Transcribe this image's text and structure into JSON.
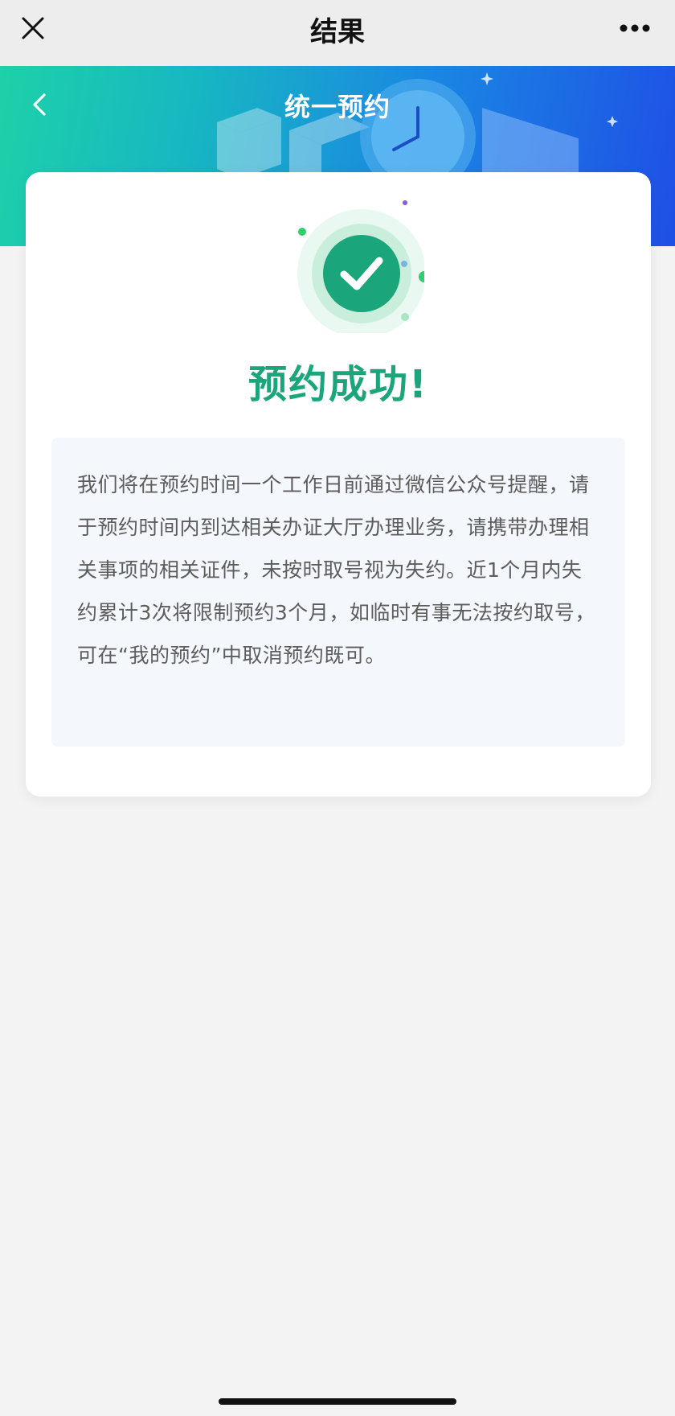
{
  "nav": {
    "title": "结果",
    "close_icon": "close-icon",
    "more_icon": "more-dots-icon"
  },
  "banner": {
    "title": "统一预约",
    "back_icon": "chevron-left-icon",
    "gradient_start": "#1dd1a8",
    "gradient_end": "#1f4fe6"
  },
  "result": {
    "status_icon": "success-check-icon",
    "status_text": "预约成功!",
    "accent_color": "#1ba57a",
    "notice_text": "我们将在预约时间一个工作日前通过微信公众号提醒，请于预约时间内到达相关办证大厅办理业务，请携带办理相关事项的相关证件，未按时取号视为失约。近1个月内失约累计3次将限制预约3个月，如临时有事无法按约取号，可在“我的预约”中取消预约既可。"
  }
}
